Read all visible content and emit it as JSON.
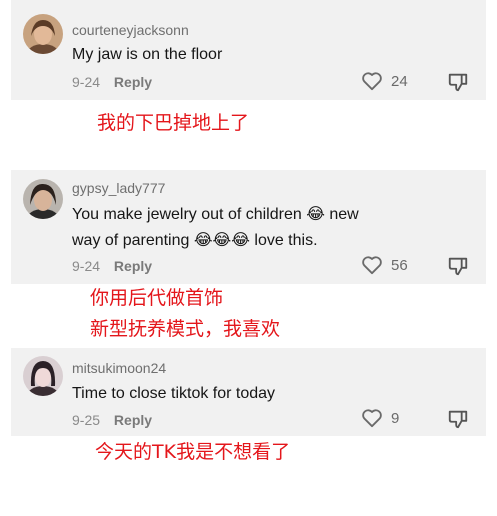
{
  "comments": [
    {
      "username": "courteneyjacksonn",
      "text": "My jaw is on the floor",
      "date": "9-24",
      "reply_label": "Reply",
      "likes": "24",
      "avatar_icon": "user-avatar-icon",
      "annotation": [
        "我的下巴掉地上了"
      ]
    },
    {
      "username": "gypsy_lady777",
      "text_line1": "You make jewelry out of children 😂 new",
      "text_line2": "way of parenting 😂😂😂 love this.",
      "date": "9-24",
      "reply_label": "Reply",
      "likes": "56",
      "avatar_icon": "user-avatar-icon",
      "annotation": [
        "你用后代做首饰",
        "新型抚养模式，我喜欢"
      ]
    },
    {
      "username": "mitsukimoon24",
      "text": "Time to close tiktok for today",
      "date": "9-25",
      "reply_label": "Reply",
      "likes": "9",
      "avatar_icon": "user-avatar-icon",
      "annotation": [
        "今天的TK我是不想看了"
      ]
    }
  ],
  "colors": {
    "annotation": "#e4161b",
    "card_bg": "#f1f1f1"
  }
}
